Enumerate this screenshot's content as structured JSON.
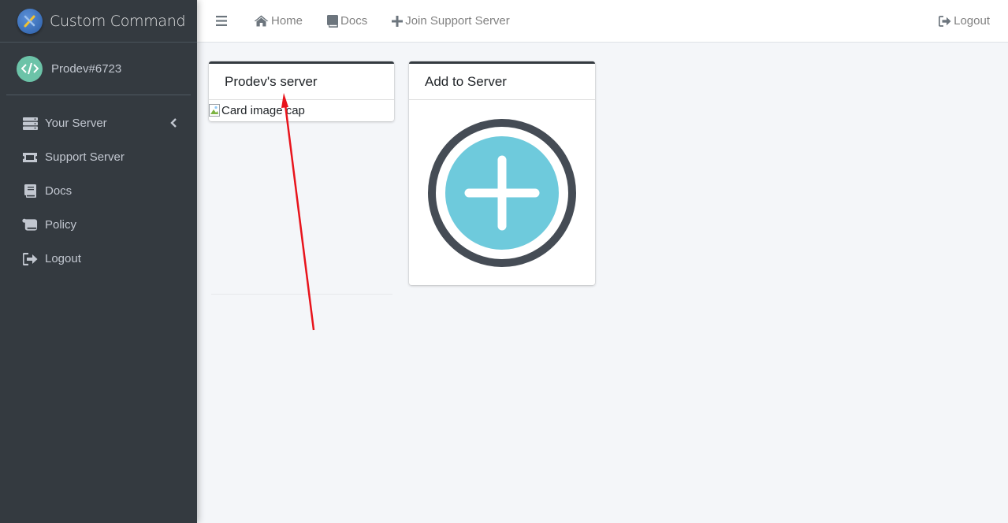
{
  "brand": {
    "title": "Custom Command",
    "logo_icon": "brand-logo-icon"
  },
  "user": {
    "name": "Prodev#6723",
    "avatar_icon": "code-icon"
  },
  "sidebar": {
    "items": [
      {
        "label": "Your Server",
        "icon": "server-icon"
      },
      {
        "label": "Support Server",
        "icon": "ticket-icon"
      },
      {
        "label": "Docs",
        "icon": "book-icon"
      },
      {
        "label": "Policy",
        "icon": "scroll-icon"
      },
      {
        "label": "Logout",
        "icon": "sign-out-icon"
      }
    ]
  },
  "topbar": {
    "home_label": "Home",
    "docs_label": "Docs",
    "join_label": "Join Support Server",
    "logout_label": "Logout"
  },
  "cards": {
    "server_card": {
      "title": "Prodev's server",
      "image_alt": "Card image cap"
    },
    "add_card": {
      "title": "Add to Server"
    }
  },
  "colors": {
    "sidebar_bg": "#343a40",
    "accent_teal": "#6ecadc",
    "ring_dark": "#454c55",
    "annotation_red": "#e8141c"
  }
}
